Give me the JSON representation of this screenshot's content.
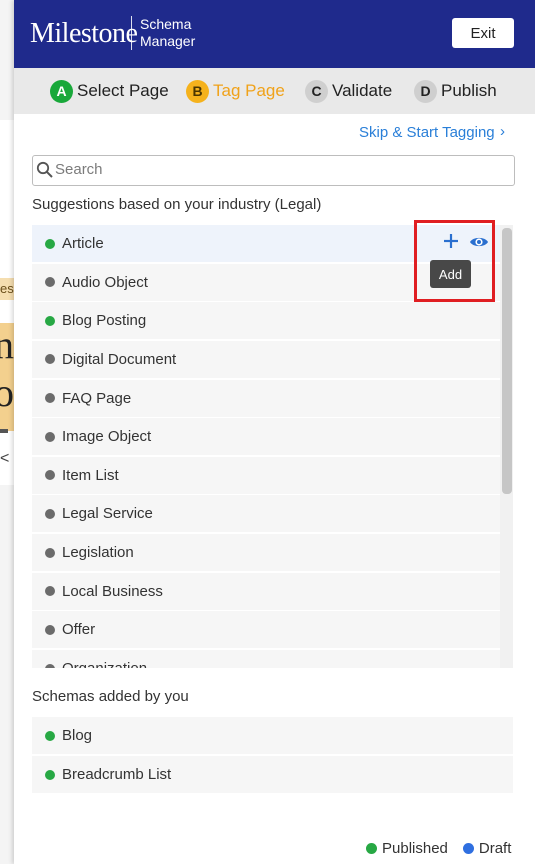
{
  "background_page": {
    "tag_text": "es",
    "big_text_1": "n",
    "big_text_2": "oc",
    "arrow_text": "<"
  },
  "header": {
    "logo": "Milestone",
    "subtitle_line1": "Schema",
    "subtitle_line2": "Manager",
    "exit_label": "Exit",
    "background_color": "#1f2a8c"
  },
  "steps": [
    {
      "letter": "A",
      "label": "Select Page",
      "state": "done",
      "color": "#19a83a"
    },
    {
      "letter": "B",
      "label": "Tag Page",
      "state": "active",
      "color": "#f5b21c"
    },
    {
      "letter": "C",
      "label": "Validate",
      "state": "pending",
      "color": "#cfcfcf"
    },
    {
      "letter": "D",
      "label": "Publish",
      "state": "pending",
      "color": "#cfcfcf"
    }
  ],
  "skip_link": "Skip & Start Tagging",
  "search": {
    "placeholder": "Search",
    "value": ""
  },
  "suggestions": {
    "heading": "Suggestions based on your industry (Legal)",
    "items": [
      {
        "label": "Article",
        "status": "published"
      },
      {
        "label": "Audio Object",
        "status": "none"
      },
      {
        "label": "Blog Posting",
        "status": "published"
      },
      {
        "label": "Digital Document",
        "status": "none"
      },
      {
        "label": "FAQ Page",
        "status": "none"
      },
      {
        "label": "Image Object",
        "status": "none"
      },
      {
        "label": "Item List",
        "status": "none"
      },
      {
        "label": "Legal Service",
        "status": "none"
      },
      {
        "label": "Legislation",
        "status": "none"
      },
      {
        "label": "Local Business",
        "status": "none"
      },
      {
        "label": "Offer",
        "status": "none"
      },
      {
        "label": "Organization",
        "status": "none"
      }
    ],
    "hover_actions": {
      "add_icon": "plus-icon",
      "view_icon": "eye-icon",
      "tooltip": "Add"
    }
  },
  "added": {
    "heading": "Schemas added by you",
    "items": [
      {
        "label": "Blog",
        "status": "published"
      },
      {
        "label": "Breadcrumb List",
        "status": "published"
      }
    ]
  },
  "legend": {
    "published_label": "Published",
    "draft_label": "Draft",
    "published_color": "#27a844",
    "draft_color": "#2f6fe0",
    "none_color": "#6b6b6b"
  }
}
